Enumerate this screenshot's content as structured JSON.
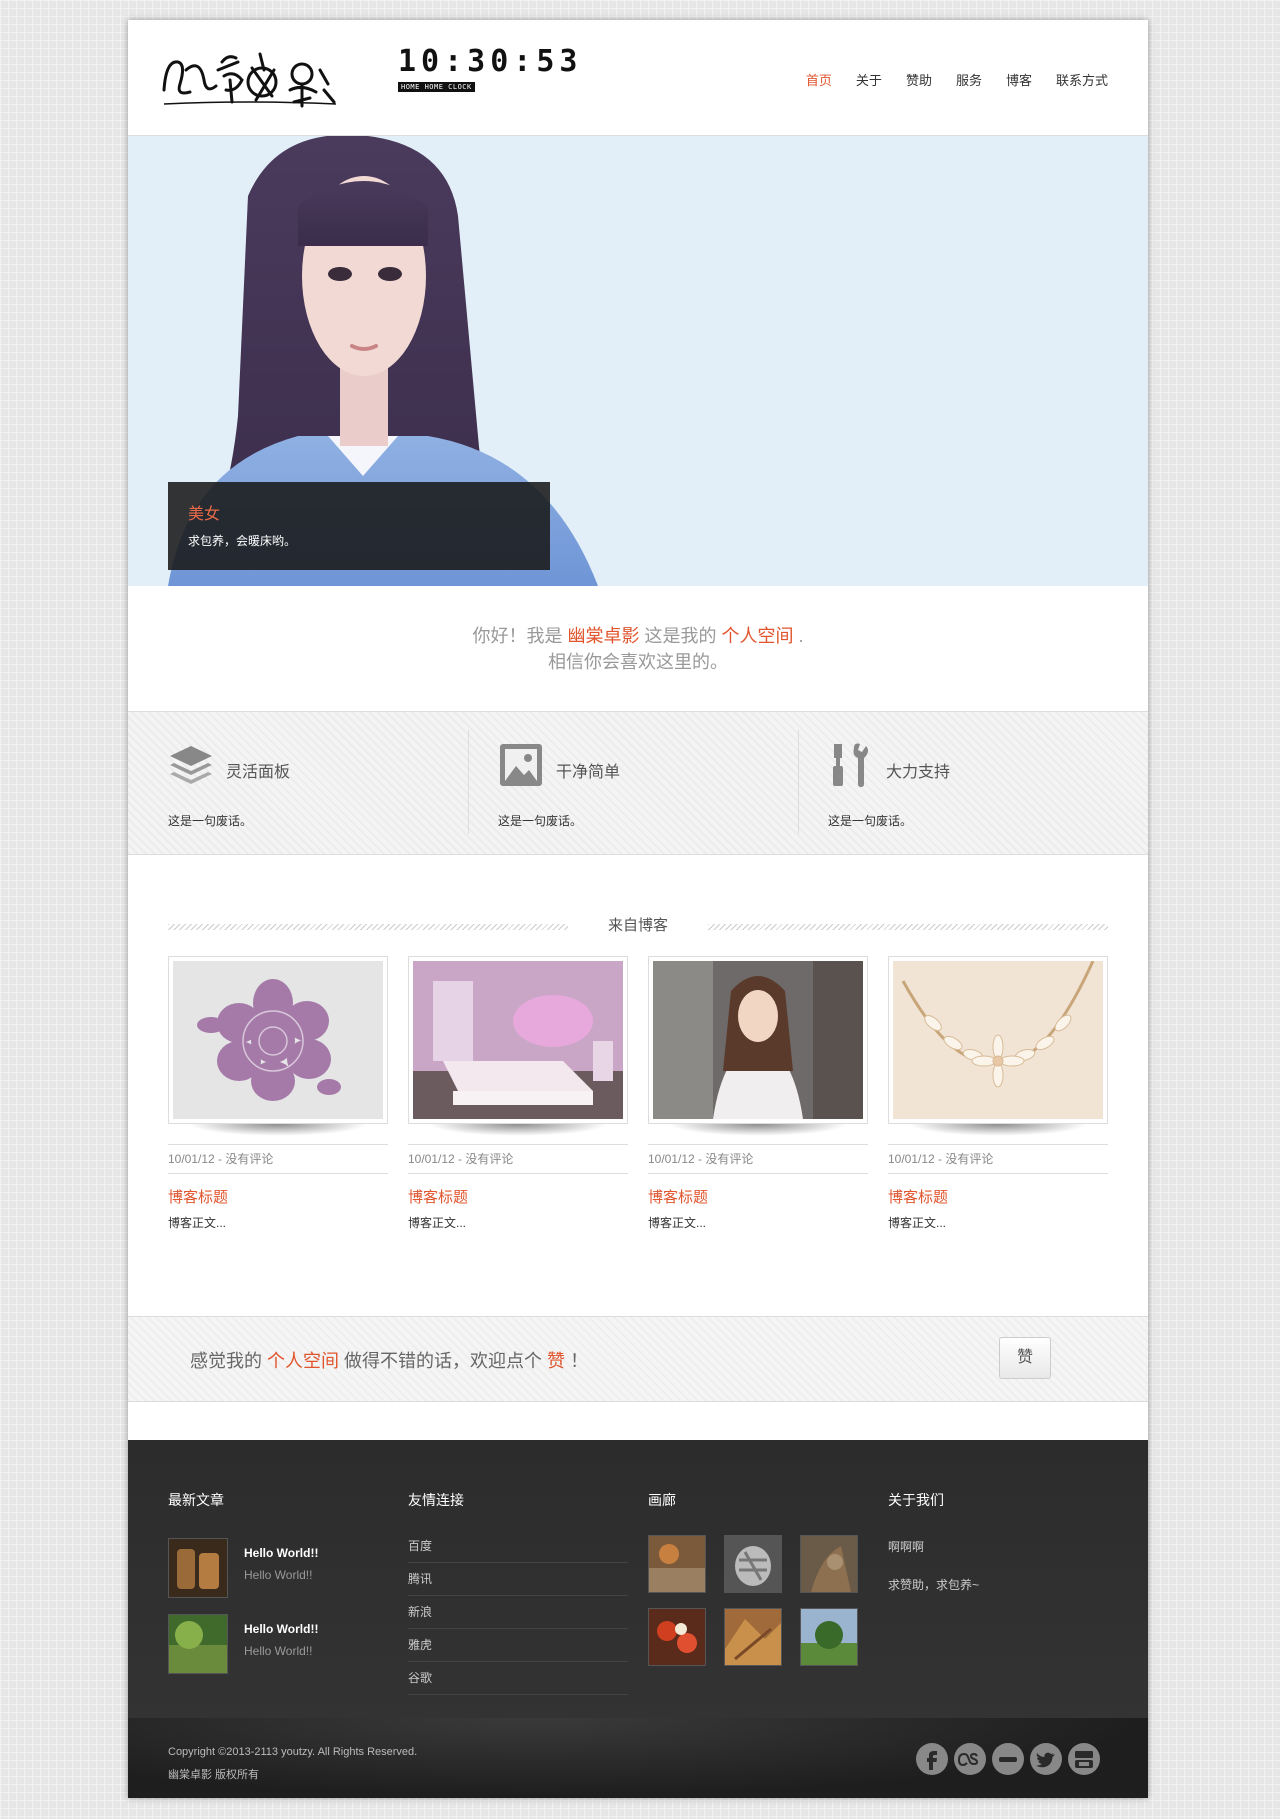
{
  "header": {
    "logo_text": "幽棠卓影",
    "clock": {
      "time": "10:30:53",
      "caption": "HOME HOME CLOCK"
    },
    "nav": [
      {
        "label": "首页",
        "active": true
      },
      {
        "label": "关于",
        "active": false
      },
      {
        "label": "赞助",
        "active": false
      },
      {
        "label": "服务",
        "active": false
      },
      {
        "label": "博客",
        "active": false
      },
      {
        "label": "联系方式",
        "active": false
      }
    ]
  },
  "hero": {
    "caption_title": "美女",
    "caption_text": "求包养，会暖床哟。"
  },
  "intro": {
    "p1": "你好！我是",
    "name": "幽棠卓影",
    "p2": "这是我的",
    "space": "个人空间",
    "p3": ".",
    "line2": "相信你会喜欢这里的。"
  },
  "features": [
    {
      "icon": "layers-icon",
      "title": "灵活面板",
      "text": "这是一句废话。"
    },
    {
      "icon": "image-icon",
      "title": "干净简单",
      "text": "这是一句废话。"
    },
    {
      "icon": "tools-icon",
      "title": "大力支持",
      "text": "这是一句废话。"
    }
  ],
  "blog": {
    "heading": "来自博客",
    "posts": [
      {
        "meta": "10/01/12 - 没有评论",
        "title": "博客标题",
        "text": "博客正文..."
      },
      {
        "meta": "10/01/12 - 没有评论",
        "title": "博客标题",
        "text": "博客正文..."
      },
      {
        "meta": "10/01/12 - 没有评论",
        "title": "博客标题",
        "text": "博客正文..."
      },
      {
        "meta": "10/01/12 - 没有评论",
        "title": "博客标题",
        "text": "博客正文..."
      }
    ]
  },
  "cta": {
    "t1": "感觉我的",
    "space": "个人空间",
    "t2": "做得不错的话，欢迎点个",
    "like": "赞",
    "t3": "！",
    "button": "赞"
  },
  "footer": {
    "recent": {
      "heading": "最新文章",
      "items": [
        {
          "title": "Hello World!!",
          "sub": "Hello World!!"
        },
        {
          "title": "Hello World!!",
          "sub": "Hello World!!"
        }
      ]
    },
    "links": {
      "heading": "友情连接",
      "items": [
        "百度",
        "腾讯",
        "新浪",
        "雅虎",
        "谷歌"
      ]
    },
    "gallery": {
      "heading": "画廊"
    },
    "about": {
      "heading": "关于我们",
      "line1": "啊啊啊",
      "line2": "求赞助，求包养~"
    },
    "copyright": "Copyright ©2013-2113 youtzy. All Rights Reserved.",
    "rights": "幽棠卓影 版权所有",
    "social": [
      "facebook-icon",
      "lastfm-icon",
      "minus-icon",
      "twitter-icon",
      "youtube-icon"
    ]
  },
  "colors": {
    "accent": "#e0552d",
    "footer_bg": "#2c2c2c"
  }
}
